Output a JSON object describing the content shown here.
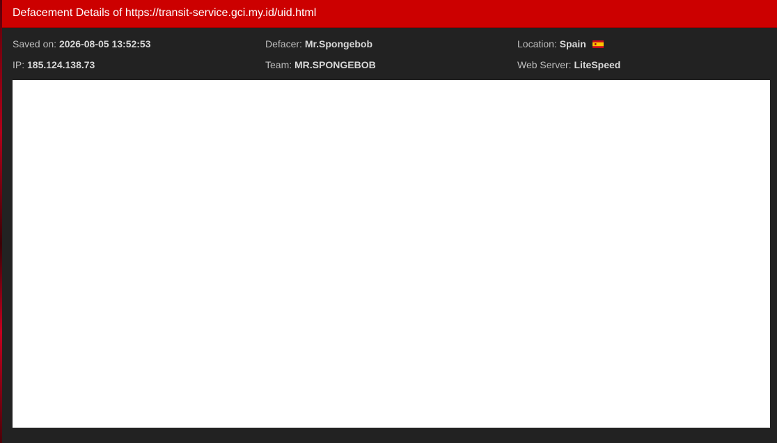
{
  "header": {
    "title": "Defacement Details of https://transit-service.gci.my.id/uid.html"
  },
  "details": {
    "saved_on_label": "Saved on:",
    "saved_on_value": "2026-08-05 13:52:53",
    "defacer_label": "Defacer:",
    "defacer_value": "Mr.Spongebob",
    "location_label": "Location:",
    "location_value": "Spain",
    "location_flag_icon": "spain-flag-icon",
    "ip_label": "IP:",
    "ip_value": "185.124.138.73",
    "team_label": "Team:",
    "team_value": "MR.SPONGEBOB",
    "web_server_label": "Web Server:",
    "web_server_value": "LiteSpeed"
  },
  "colors": {
    "header_bg": "#cc0000",
    "panel_bg": "#222222",
    "frame_bg": "#ffffff"
  }
}
